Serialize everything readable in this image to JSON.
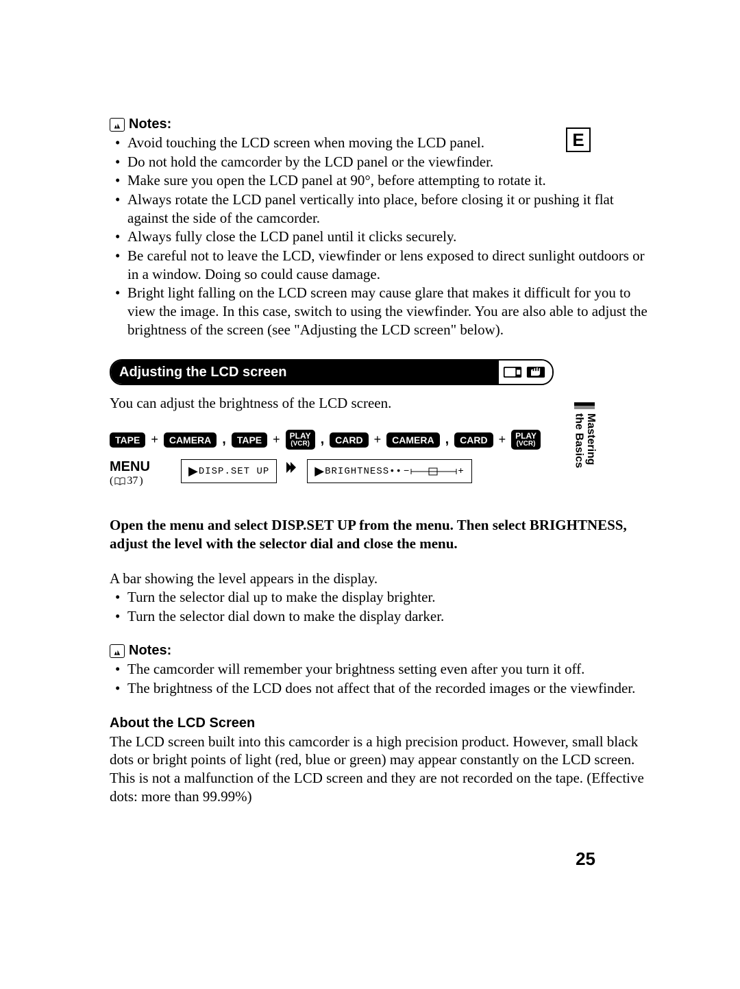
{
  "corner_letter": "E",
  "notes1": {
    "heading": "Notes:",
    "items": [
      "Avoid touching the LCD screen when moving the LCD panel.",
      "Do not hold the camcorder by the LCD panel or the viewfinder.",
      "Make sure you open the LCD panel at 90°, before attempting to rotate it.",
      "Always rotate the LCD panel vertically into place, before closing it or pushing it flat against the side of the camcorder.",
      "Always fully close the LCD panel until it clicks securely.",
      "Be careful not to leave the LCD, viewfinder or lens exposed to direct sunlight outdoors or in a window. Doing so could cause damage.",
      "Bright light falling on the LCD screen may cause glare that makes it difficult for you to view the image. In this case, switch to using the viewfinder. You are also able to adjust the brightness of the screen (see \"Adjusting the LCD screen\" below)."
    ]
  },
  "section_title": "Adjusting the LCD screen",
  "intro": "You can adjust the brightness of the LCD screen.",
  "modes": {
    "tape": "TAPE",
    "camera": "CAMERA",
    "play": "PLAY",
    "vcr_sub": "(VCR)",
    "card": "CARD"
  },
  "menu": {
    "label": "MENU",
    "ref_prefix": "( ",
    "ref_page": "37",
    "ref_suffix": ")",
    "step1": "DISP.SET UP",
    "step2": "BRIGHTNESS••",
    "step2_minus": "−",
    "step2_plus": "+"
  },
  "instruction": "Open the menu and select DISP.SET UP from the menu. Then select BRIGHTNESS, adjust the level with the selector dial and close the menu.",
  "body1": "A bar showing the level appears in the display.",
  "sub_bullets": [
    "Turn the selector dial up to make the display brighter.",
    "Turn the selector dial down to make the display darker."
  ],
  "notes2": {
    "heading": "Notes:",
    "items": [
      "The camcorder will remember your brightness setting even after you turn it off.",
      "The brightness of the LCD does not affect that of the recorded images or the viewfinder."
    ]
  },
  "about": {
    "heading": "About the LCD Screen",
    "text": "The LCD screen built into this camcorder is a high precision product. However, small black dots or bright points of light (red, blue or green) may appear constantly on the LCD screen. This is not a malfunction of the LCD screen and they are not recorded on the tape. (Effective dots: more than 99.99%)"
  },
  "side_tab": "Mastering\nthe Basics",
  "page_number": "25"
}
